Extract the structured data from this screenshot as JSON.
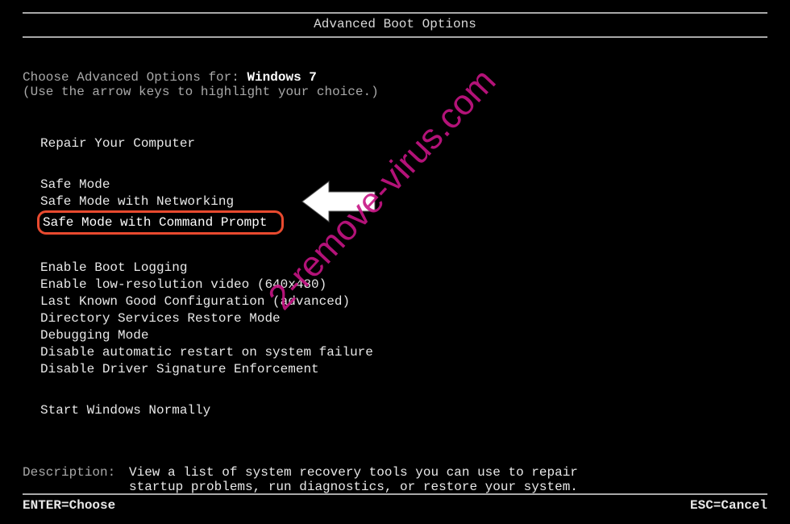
{
  "title": "Advanced Boot Options",
  "instructions": {
    "line1_prefix": "Choose Advanced Options for: ",
    "os_name": "Windows 7",
    "line2": "(Use the arrow keys to highlight your choice.)"
  },
  "menu": {
    "repair": "Repair Your Computer",
    "safe_mode": "Safe Mode",
    "safe_mode_net": "Safe Mode with Networking",
    "safe_mode_cmd": "Safe Mode with Command Prompt",
    "boot_log": "Enable Boot Logging",
    "low_res": "Enable low-resolution video (640x480)",
    "last_known": "Last Known Good Configuration (advanced)",
    "dir_svc": "Directory Services Restore Mode",
    "debug": "Debugging Mode",
    "no_restart": "Disable automatic restart on system failure",
    "no_sig": "Disable Driver Signature Enforcement",
    "normal": "Start Windows Normally"
  },
  "description": {
    "label": "Description:",
    "text1": "View a list of system recovery tools you can use to repair",
    "text2": "startup problems, run diagnostics, or restore your system."
  },
  "footer": {
    "enter": "ENTER=Choose",
    "esc": "ESC=Cancel"
  },
  "watermark": "2-remove-virus.com",
  "highlight_color": "#e84a2f",
  "watermark_color": "#c71585"
}
